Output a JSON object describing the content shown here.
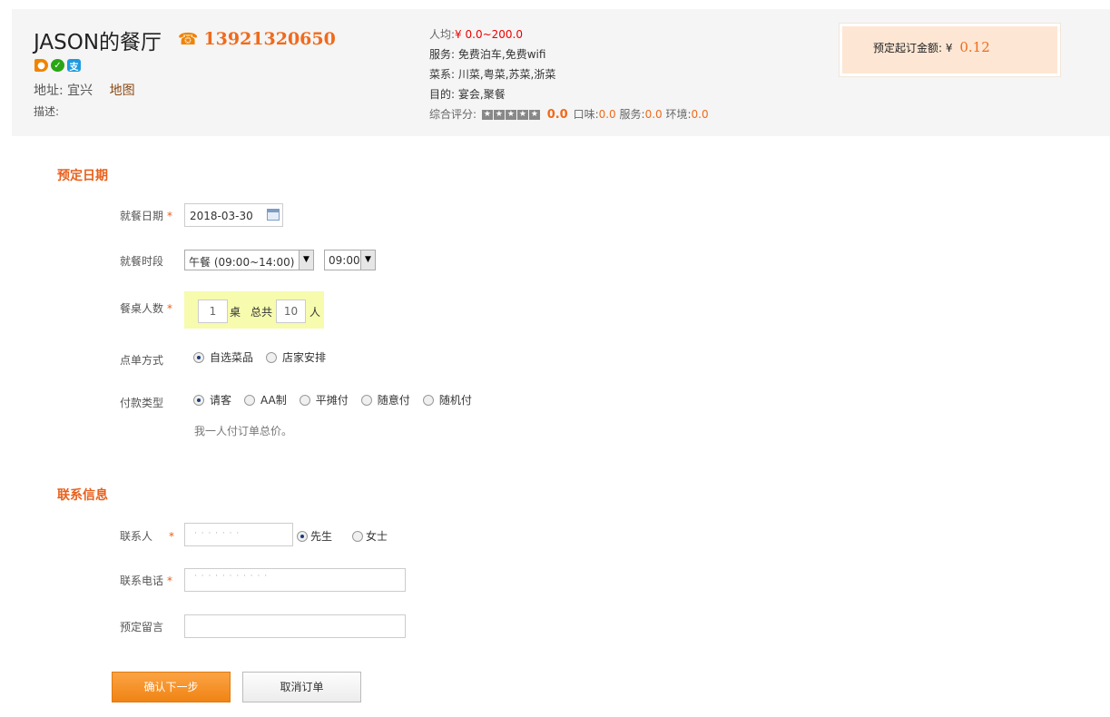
{
  "restaurant": {
    "name": "JASON的餐厅",
    "phone": "13921320650",
    "address_label": "地址:",
    "address_value": "宜兴",
    "map_link": "地图",
    "desc_label": "描述:"
  },
  "info": {
    "avg_label": "人均:",
    "avg_value": "¥ 0.0~200.0",
    "service_label": "服务:",
    "service_value": "免费泊车,免费wifi",
    "cuisine_label": "菜系:",
    "cuisine_value": "川菜,粤菜,苏菜,浙菜",
    "purpose_label": "目的:",
    "purpose_value": "宴会,聚餐",
    "rating_label": "综合评分:",
    "rating_overall": "0.0",
    "taste_label": "口味:",
    "taste_value": "0.0",
    "service_score_label": "服务:",
    "service_score_value": "0.0",
    "env_label": "环境:",
    "env_value": "0.0"
  },
  "min_order": {
    "label": "预定起订金额:",
    "currency": "¥",
    "amount": "0.12"
  },
  "section_date": {
    "title": "预定日期",
    "date_label": "就餐日期",
    "date_value": "2018-03-30",
    "period_label": "就餐时段",
    "period_value": "午餐 (09:00~14:00)",
    "time_value": "09:00",
    "people_label": "餐桌人数",
    "tables_value": "1",
    "tables_unit": "桌",
    "total_label": "总共",
    "people_value": "10",
    "people_unit": "人",
    "order_label": "点单方式",
    "order_options": [
      "自选菜品",
      "店家安排"
    ],
    "pay_label": "付款类型",
    "pay_options": [
      "请客",
      "AA制",
      "平摊付",
      "随意付",
      "随机付"
    ],
    "pay_note": "我一人付订单总价。"
  },
  "section_contact": {
    "title": "联系信息",
    "contact_label": "联系人",
    "gender_options": [
      "先生",
      "女士"
    ],
    "phone_label": "联系电话",
    "message_label": "预定留言"
  },
  "buttons": {
    "confirm": "确认下一步",
    "cancel": "取消订单"
  },
  "colors": {
    "accent": "#e8601c",
    "price_red": "#e00000",
    "highlight": "#f6fbae",
    "min_box_bg": "#fde7d4"
  }
}
